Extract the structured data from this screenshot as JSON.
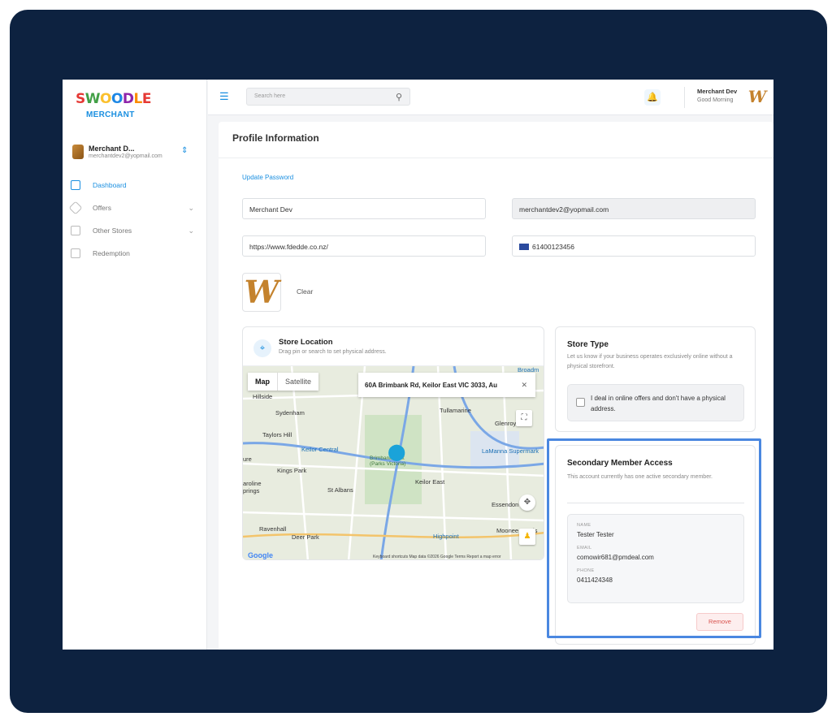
{
  "brand": {
    "logo_letters": [
      "S",
      "W",
      "O",
      "O",
      "D",
      "L",
      "E"
    ],
    "subtitle": "MERCHANT"
  },
  "sidebar": {
    "user_name": "Merchant D...",
    "user_email": "merchantdev2@yopmail.com",
    "items": [
      {
        "label": "Dashboard",
        "icon": "dashboard-icon",
        "active": true
      },
      {
        "label": "Offers",
        "icon": "tag-icon",
        "expandable": true
      },
      {
        "label": "Other Stores",
        "icon": "store-icon",
        "expandable": true
      },
      {
        "label": "Redemption",
        "icon": "calendar-icon"
      }
    ]
  },
  "topbar": {
    "search_placeholder": "Search here",
    "user_name": "Merchant Dev",
    "greeting": "Good Morning"
  },
  "profile": {
    "title": "Profile Information",
    "update_password": "Update Password",
    "name_value": "Merchant Dev",
    "email_value": "merchantdev2@yopmail.com",
    "website_value": "https://www.fdedde.co.nz/",
    "phone_code": "+",
    "phone_value": "61400123456",
    "clear_label": "Clear"
  },
  "store_location": {
    "title": "Store Location",
    "subtitle": "Drag pin or search to set physical address.",
    "map_tab": "Map",
    "satellite_tab": "Satellite",
    "address": "60A Brimbank Rd, Keilor East VIC 3033, Au",
    "map_labels": [
      "Hillside",
      "Sydenham",
      "Taylors Hill",
      "Keilor Central",
      "Kings Park",
      "St Albans",
      "Tullamarine",
      "Glenroy",
      "Keilor East",
      "LaManna Supermark",
      "Essendon",
      "Ravenhall",
      "Deer Park",
      "Highpoint",
      "Moonee Ponds",
      "Brimbank Park (Parks Victoria)",
      "Broadm",
      "ure",
      "aroline prings"
    ],
    "footer": "Keyboard shortcuts   Map data ©2026 Google   Terms   Report a map error",
    "google": "Google"
  },
  "store_type": {
    "title": "Store Type",
    "desc": "Let us know if your business operates exclusively online without a physical storefront.",
    "checkbox_label": "I deal in online offers and don't have a physical address."
  },
  "secondary_member": {
    "title": "Secondary Member Access",
    "desc": "This account currently has one active secondary member.",
    "name_label": "NAME",
    "name_value": "Tester Tester",
    "email_label": "EMAIL",
    "email_value": "comowir681@pmdeal.com",
    "phone_label": "PHONE",
    "phone_value": "0411424348",
    "remove_label": "Remove"
  },
  "colors": {
    "frame": "#0d2240",
    "accent": "#1a8fe0",
    "highlight": "#4a87e0",
    "danger": "#d9534f"
  }
}
